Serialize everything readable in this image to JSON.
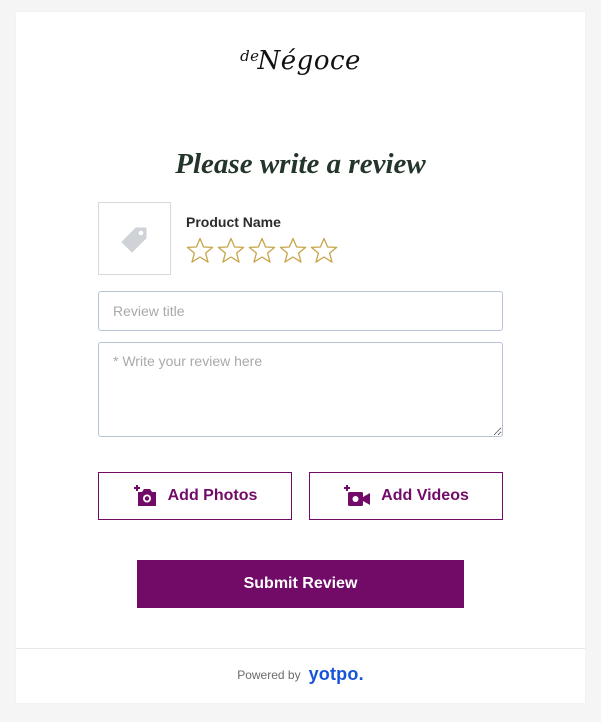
{
  "logo": {
    "prefix": "de",
    "name": "Négoce"
  },
  "form": {
    "title": "Please write a review",
    "product": {
      "name": "Product Name",
      "image_icon": "tag-icon"
    },
    "rating": {
      "max_stars": 5,
      "selected": 0,
      "star_color": "#c8a44a"
    },
    "review_title": {
      "value": "",
      "placeholder": "Review title"
    },
    "review_body": {
      "value": "",
      "placeholder": "* Write your review here"
    },
    "add_photos_label": "Add Photos",
    "add_videos_label": "Add Videos",
    "submit_label": "Submit Review"
  },
  "footer": {
    "powered_by": "Powered by",
    "brand": "yotpo."
  },
  "colors": {
    "accent": "#720b68",
    "brand": "#1653d8",
    "title_text": "#24352a"
  },
  "icons": {
    "photos": "camera-plus-icon",
    "videos": "video-camera-plus-icon"
  }
}
